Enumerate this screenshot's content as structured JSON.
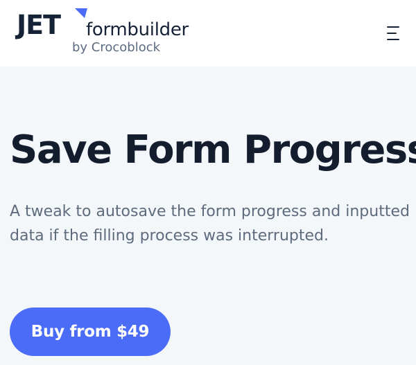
{
  "header": {
    "logo": {
      "jet": "JET",
      "product": "formbuilder",
      "byline": "by Crocoblock"
    },
    "menu_icon": "hamburger-menu-icon"
  },
  "hero": {
    "title": "Save Form Progress",
    "description": "A tweak to autosave the form progress and inputted data if the filling process was interrupted.",
    "cta_label": "Buy from $49"
  },
  "colors": {
    "accent": "#4a6cf7",
    "logo_mark": "#4a6cf7",
    "heading": "#141d2e",
    "body_text": "#5e6b7d",
    "hero_background": "#f4f7fa"
  }
}
